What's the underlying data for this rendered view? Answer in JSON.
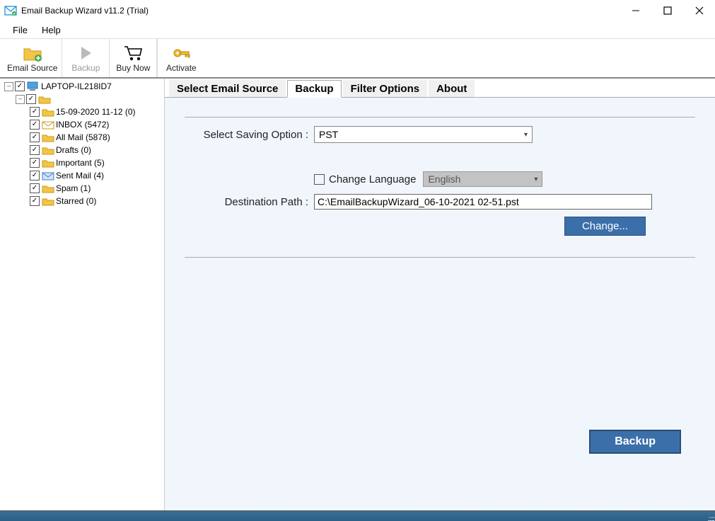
{
  "title": "Email Backup Wizard v11.2 (Trial)",
  "menu": {
    "file": "File",
    "help": "Help"
  },
  "toolbar": {
    "email_source": "Email Source",
    "backup": "Backup",
    "buy_now": "Buy Now",
    "activate": "Activate"
  },
  "tree": {
    "root": "LAPTOP-IL218ID7",
    "folders": [
      "15-09-2020 11-12 (0)",
      "INBOX (5472)",
      "All Mail (5878)",
      "Drafts (0)",
      "Important (5)",
      "Sent Mail (4)",
      "Spam (1)",
      "Starred (0)"
    ]
  },
  "tabs": {
    "t0": "Select Email Source",
    "t1": "Backup",
    "t2": "Filter Options",
    "t3": "About"
  },
  "form": {
    "saving_label": "Select Saving Option :",
    "saving_value": "PST",
    "change_lang_label": "Change Language",
    "lang_value": "English",
    "dest_label": "Destination Path :",
    "dest_value": "C:\\EmailBackupWizard_06-10-2021 02-51.pst",
    "change_btn": "Change...",
    "backup_btn": "Backup"
  },
  "expanders": {
    "minus": "–"
  }
}
